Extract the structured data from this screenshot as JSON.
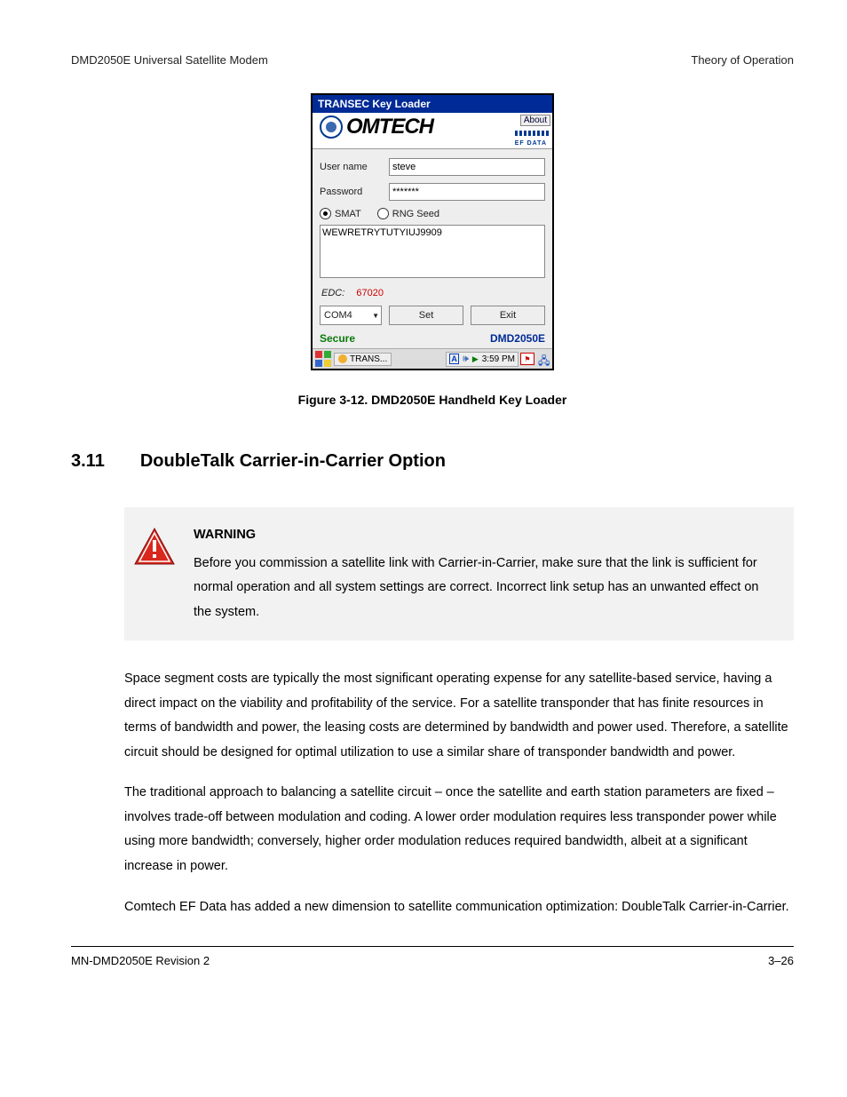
{
  "header": {
    "left": "DMD2050E Universal Satellite Modem",
    "right": "Theory of Operation"
  },
  "app": {
    "title": "TRANSEC Key Loader",
    "about": "About",
    "brand": "OMTECH",
    "brand_sub": "EF DATA",
    "username_label": "User name",
    "username_value": "steve",
    "password_label": "Password",
    "password_value": "*******",
    "radio_smat": "SMAT",
    "radio_rng": "RNG Seed",
    "key_text": "WEWRETRYTUTYIUJ9909",
    "edc_label": "EDC:",
    "edc_value": "67020",
    "port": "COM4",
    "set_btn": "Set",
    "exit_btn": "Exit",
    "status_secure": "Secure",
    "status_device": "DMD2050E",
    "task_label": "TRANS...",
    "tray_letter": "A",
    "tray_time": "3:59 PM"
  },
  "figcap": "Figure 3-12. DMD2050E Handheld Key Loader",
  "section": {
    "num": "3.11",
    "title": "DoubleTalk Carrier-in-Carrier Option"
  },
  "warning": {
    "title": "WARNING",
    "body": "Before you commission a satellite link with Carrier-in-Carrier, make sure that the link is sufficient for normal operation and all system settings are correct. Incorrect link setup has an unwanted effect on the system."
  },
  "p1": "Space segment costs are typically the most significant operating expense for any satellite-based service, having a direct impact on the viability and profitability of the service. For a satellite transponder that has finite resources in terms of bandwidth and power, the leasing costs are determined by bandwidth and power used. Therefore, a satellite circuit should be designed for optimal utilization to use a similar share of transponder bandwidth and power.",
  "p2": "The traditional approach to balancing a satellite circuit – once the satellite and earth station parameters are fixed – involves trade-off between modulation and coding. A lower order modulation requires less transponder power while using more bandwidth; conversely, higher order modulation reduces required bandwidth, albeit at a significant increase in power.",
  "p3": "Comtech EF Data has added a new dimension to satellite communication optimization: DoubleTalk Carrier-in-Carrier.",
  "footer": {
    "left": "MN-DMD2050E   Revision 2",
    "right": "3–26"
  }
}
